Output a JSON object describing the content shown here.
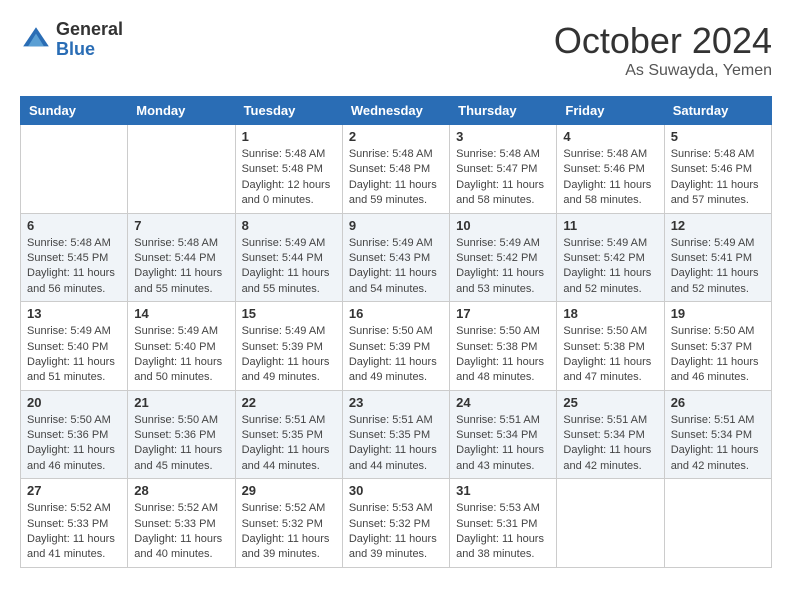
{
  "header": {
    "logo_general": "General",
    "logo_blue": "Blue",
    "month_title": "October 2024",
    "location": "As Suwayda, Yemen"
  },
  "calendar": {
    "days_of_week": [
      "Sunday",
      "Monday",
      "Tuesday",
      "Wednesday",
      "Thursday",
      "Friday",
      "Saturday"
    ],
    "weeks": [
      [
        {
          "day": "",
          "info": ""
        },
        {
          "day": "",
          "info": ""
        },
        {
          "day": "1",
          "info": "Sunrise: 5:48 AM\nSunset: 5:48 PM\nDaylight: 12 hours\nand 0 minutes."
        },
        {
          "day": "2",
          "info": "Sunrise: 5:48 AM\nSunset: 5:48 PM\nDaylight: 11 hours\nand 59 minutes."
        },
        {
          "day": "3",
          "info": "Sunrise: 5:48 AM\nSunset: 5:47 PM\nDaylight: 11 hours\nand 58 minutes."
        },
        {
          "day": "4",
          "info": "Sunrise: 5:48 AM\nSunset: 5:46 PM\nDaylight: 11 hours\nand 58 minutes."
        },
        {
          "day": "5",
          "info": "Sunrise: 5:48 AM\nSunset: 5:46 PM\nDaylight: 11 hours\nand 57 minutes."
        }
      ],
      [
        {
          "day": "6",
          "info": "Sunrise: 5:48 AM\nSunset: 5:45 PM\nDaylight: 11 hours\nand 56 minutes."
        },
        {
          "day": "7",
          "info": "Sunrise: 5:48 AM\nSunset: 5:44 PM\nDaylight: 11 hours\nand 55 minutes."
        },
        {
          "day": "8",
          "info": "Sunrise: 5:49 AM\nSunset: 5:44 PM\nDaylight: 11 hours\nand 55 minutes."
        },
        {
          "day": "9",
          "info": "Sunrise: 5:49 AM\nSunset: 5:43 PM\nDaylight: 11 hours\nand 54 minutes."
        },
        {
          "day": "10",
          "info": "Sunrise: 5:49 AM\nSunset: 5:42 PM\nDaylight: 11 hours\nand 53 minutes."
        },
        {
          "day": "11",
          "info": "Sunrise: 5:49 AM\nSunset: 5:42 PM\nDaylight: 11 hours\nand 52 minutes."
        },
        {
          "day": "12",
          "info": "Sunrise: 5:49 AM\nSunset: 5:41 PM\nDaylight: 11 hours\nand 52 minutes."
        }
      ],
      [
        {
          "day": "13",
          "info": "Sunrise: 5:49 AM\nSunset: 5:40 PM\nDaylight: 11 hours\nand 51 minutes."
        },
        {
          "day": "14",
          "info": "Sunrise: 5:49 AM\nSunset: 5:40 PM\nDaylight: 11 hours\nand 50 minutes."
        },
        {
          "day": "15",
          "info": "Sunrise: 5:49 AM\nSunset: 5:39 PM\nDaylight: 11 hours\nand 49 minutes."
        },
        {
          "day": "16",
          "info": "Sunrise: 5:50 AM\nSunset: 5:39 PM\nDaylight: 11 hours\nand 49 minutes."
        },
        {
          "day": "17",
          "info": "Sunrise: 5:50 AM\nSunset: 5:38 PM\nDaylight: 11 hours\nand 48 minutes."
        },
        {
          "day": "18",
          "info": "Sunrise: 5:50 AM\nSunset: 5:38 PM\nDaylight: 11 hours\nand 47 minutes."
        },
        {
          "day": "19",
          "info": "Sunrise: 5:50 AM\nSunset: 5:37 PM\nDaylight: 11 hours\nand 46 minutes."
        }
      ],
      [
        {
          "day": "20",
          "info": "Sunrise: 5:50 AM\nSunset: 5:36 PM\nDaylight: 11 hours\nand 46 minutes."
        },
        {
          "day": "21",
          "info": "Sunrise: 5:50 AM\nSunset: 5:36 PM\nDaylight: 11 hours\nand 45 minutes."
        },
        {
          "day": "22",
          "info": "Sunrise: 5:51 AM\nSunset: 5:35 PM\nDaylight: 11 hours\nand 44 minutes."
        },
        {
          "day": "23",
          "info": "Sunrise: 5:51 AM\nSunset: 5:35 PM\nDaylight: 11 hours\nand 44 minutes."
        },
        {
          "day": "24",
          "info": "Sunrise: 5:51 AM\nSunset: 5:34 PM\nDaylight: 11 hours\nand 43 minutes."
        },
        {
          "day": "25",
          "info": "Sunrise: 5:51 AM\nSunset: 5:34 PM\nDaylight: 11 hours\nand 42 minutes."
        },
        {
          "day": "26",
          "info": "Sunrise: 5:51 AM\nSunset: 5:34 PM\nDaylight: 11 hours\nand 42 minutes."
        }
      ],
      [
        {
          "day": "27",
          "info": "Sunrise: 5:52 AM\nSunset: 5:33 PM\nDaylight: 11 hours\nand 41 minutes."
        },
        {
          "day": "28",
          "info": "Sunrise: 5:52 AM\nSunset: 5:33 PM\nDaylight: 11 hours\nand 40 minutes."
        },
        {
          "day": "29",
          "info": "Sunrise: 5:52 AM\nSunset: 5:32 PM\nDaylight: 11 hours\nand 39 minutes."
        },
        {
          "day": "30",
          "info": "Sunrise: 5:53 AM\nSunset: 5:32 PM\nDaylight: 11 hours\nand 39 minutes."
        },
        {
          "day": "31",
          "info": "Sunrise: 5:53 AM\nSunset: 5:31 PM\nDaylight: 11 hours\nand 38 minutes."
        },
        {
          "day": "",
          "info": ""
        },
        {
          "day": "",
          "info": ""
        }
      ]
    ]
  }
}
